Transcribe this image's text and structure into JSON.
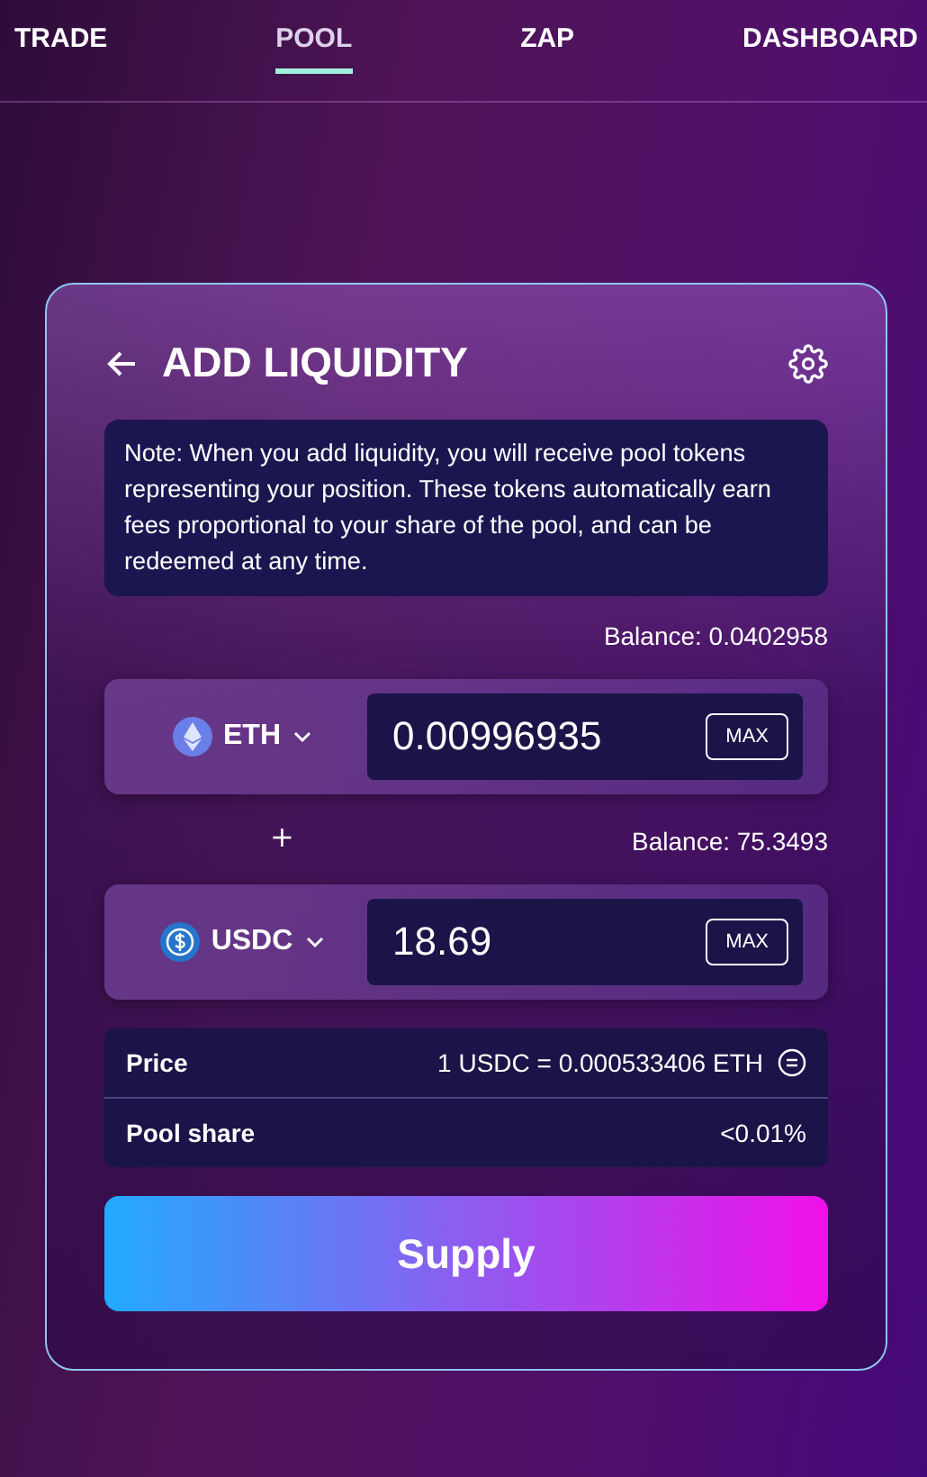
{
  "nav": [
    {
      "label": "TRADE",
      "selected": false
    },
    {
      "label": "POOL",
      "selected": true
    },
    {
      "label": "ZAP",
      "selected": false
    },
    {
      "label": "DASHBOARD",
      "selected": false
    }
  ],
  "card": {
    "title": "ADD LIQUIDITY",
    "note": "Note: When you add liquidity, you will receive pool tokens representing your position. These tokens automatically earn fees proportional to your share of the pool, and can be redeemed at any time.",
    "inputs": [
      {
        "balance": "Balance: 0.0402958",
        "token": "ETH",
        "value": "0.00996935",
        "max": "MAX"
      },
      {
        "balance": "Balance: 75.3493",
        "token": "USDC",
        "value": "18.69",
        "max": "MAX"
      }
    ],
    "plus": "+",
    "details": [
      {
        "label": "Price",
        "value": "1 USDC = 0.000533406 ETH",
        "kind": "toggle"
      },
      {
        "label": "Pool share",
        "value": "<0.01%",
        "kind": "plain"
      }
    ],
    "button": "Supply"
  }
}
